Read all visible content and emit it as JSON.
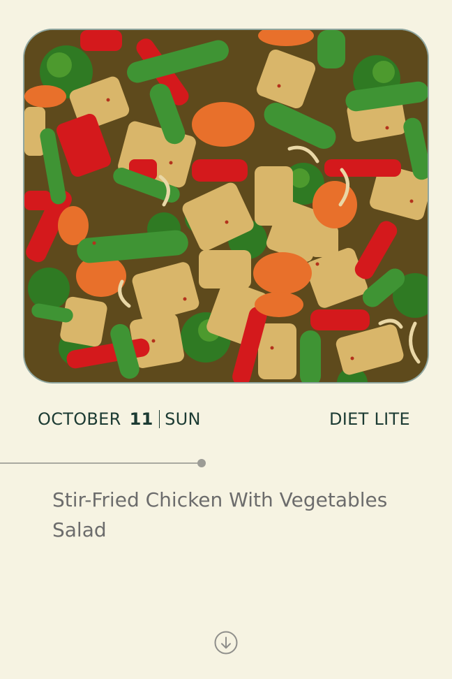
{
  "hero": {
    "alt": "Stir-fried chicken with vegetables",
    "icon": "food-photo"
  },
  "date": {
    "month": "OCTOBER",
    "day": "11",
    "weekday": "SUN"
  },
  "diet_label": "DIET LITE",
  "dish_title": "Stir-Fried Chicken With Vegetables Salad",
  "progress": {
    "fraction": 0.45
  },
  "scroll_icon": "arrow-down-circle-icon",
  "colors": {
    "background": "#f6f3e2",
    "text_dark": "#1c3b33",
    "text_muted": "#6c6c6c",
    "frame_border": "#8fa6a0"
  }
}
